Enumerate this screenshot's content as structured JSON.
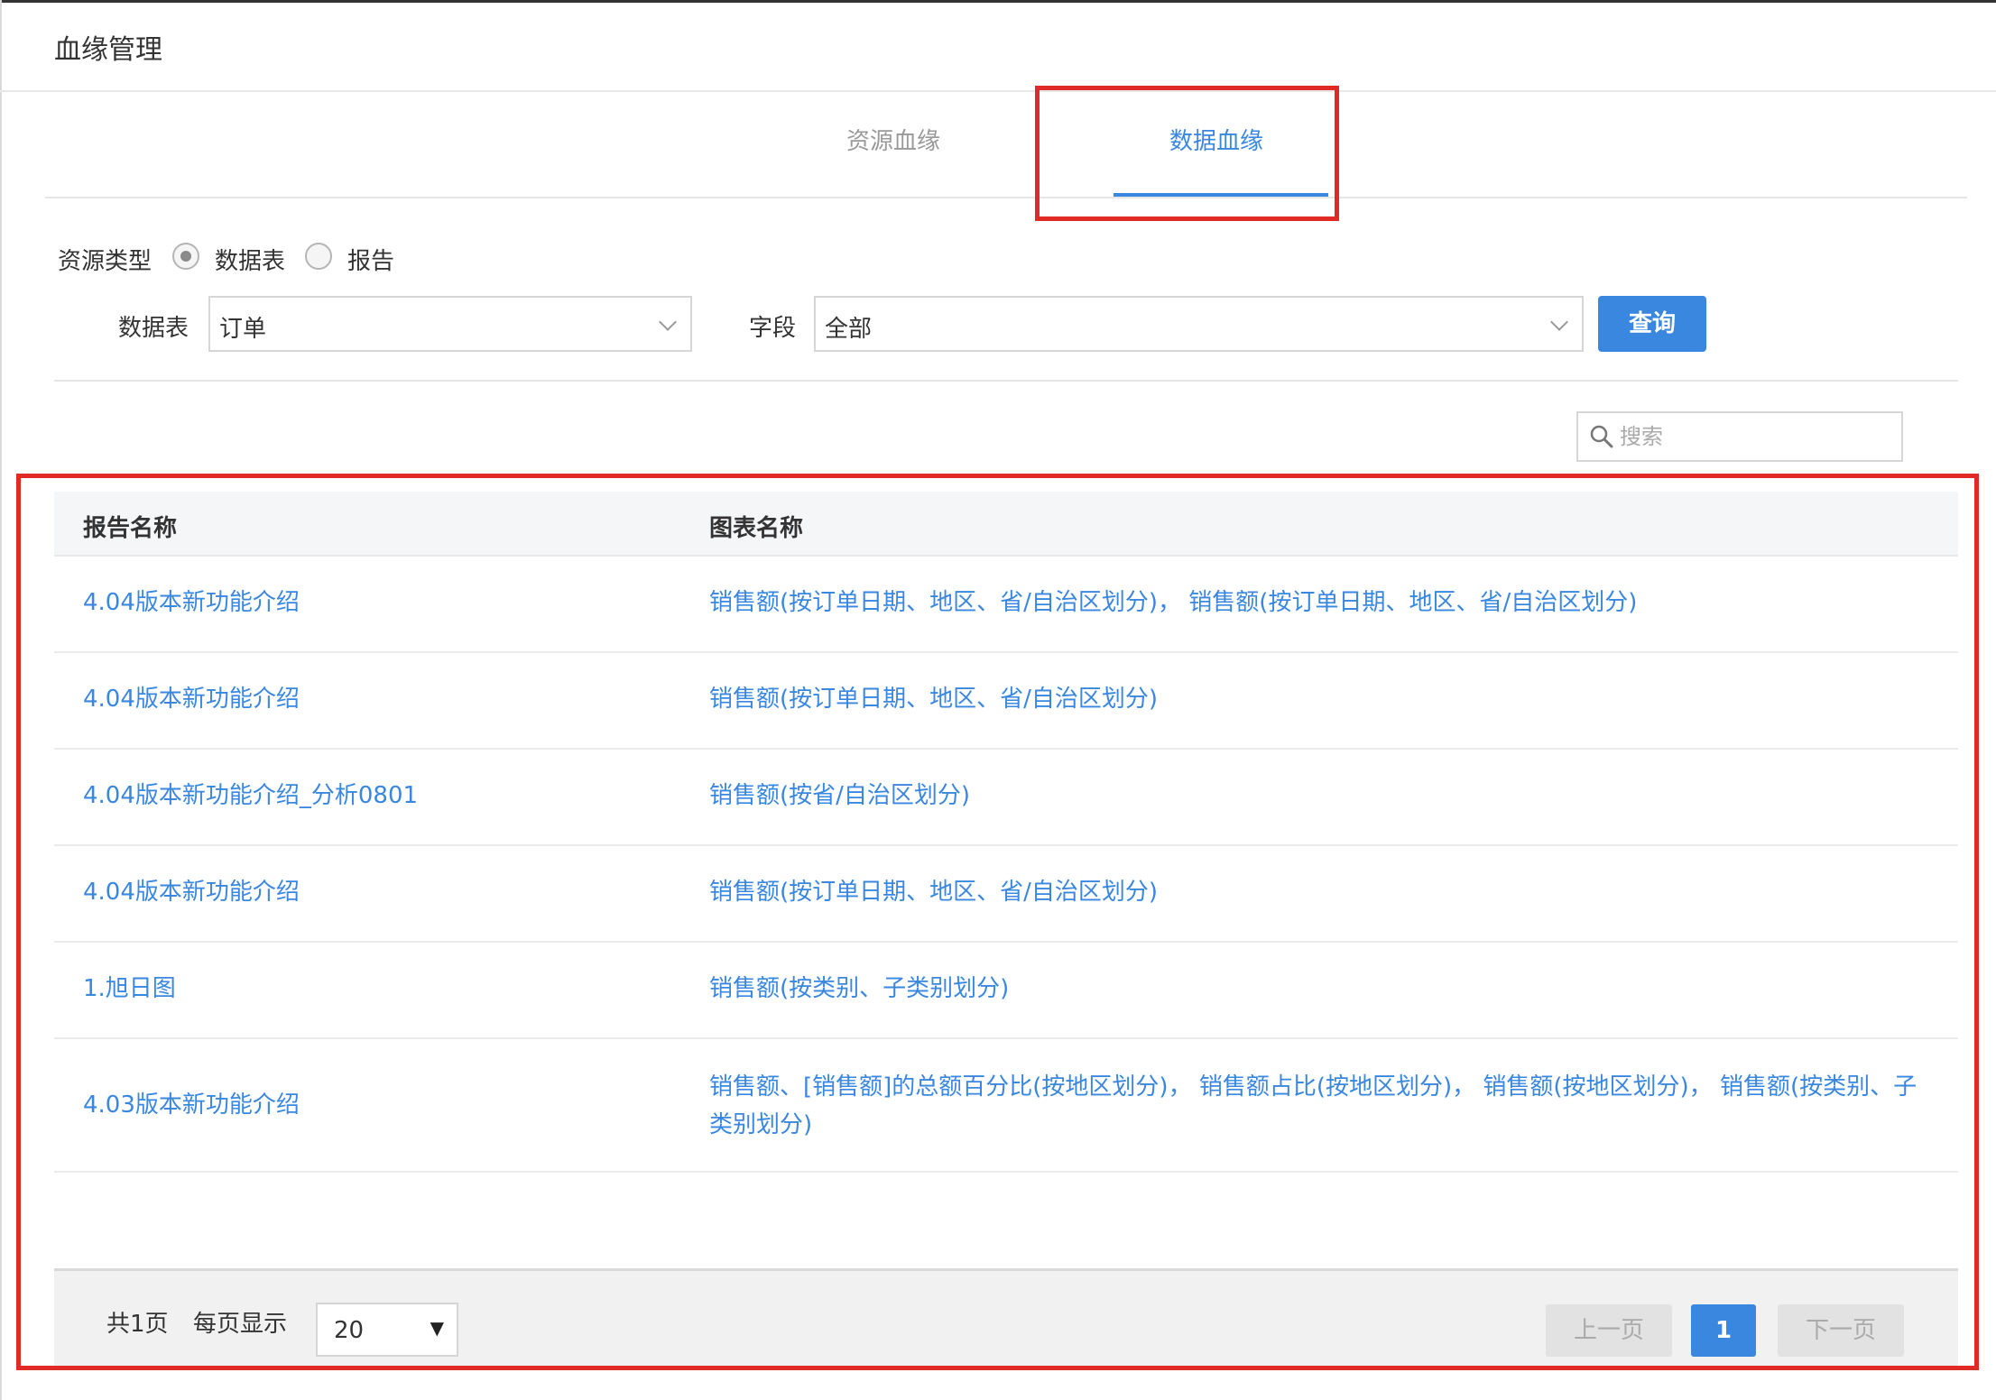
{
  "page": {
    "title": "血缘管理"
  },
  "tabs": [
    {
      "label": "资源血缘",
      "active": false
    },
    {
      "label": "数据血缘",
      "active": true
    }
  ],
  "filters": {
    "resource_type_label": "资源类型",
    "options": [
      {
        "label": "数据表",
        "checked": true
      },
      {
        "label": "报告",
        "checked": false
      }
    ],
    "table_label": "数据表",
    "table_value": "订单",
    "field_label": "字段",
    "field_value": "全部",
    "query_button": "查询"
  },
  "search": {
    "placeholder": "搜索",
    "value": ""
  },
  "table": {
    "headers": [
      "报告名称",
      "图表名称"
    ],
    "rows": [
      {
        "report": "4.04版本新功能介绍",
        "charts": "销售额(按订单日期、地区、省/自治区划分)，  销售额(按订单日期、地区、省/自治区划分)"
      },
      {
        "report": "4.04版本新功能介绍",
        "charts": "销售额(按订单日期、地区、省/自治区划分)"
      },
      {
        "report": "4.04版本新功能介绍_分析0801",
        "charts": "销售额(按省/自治区划分)"
      },
      {
        "report": "4.04版本新功能介绍",
        "charts": "销售额(按订单日期、地区、省/自治区划分)"
      },
      {
        "report": "1.旭日图",
        "charts": "销售额(按类别、子类别划分)"
      },
      {
        "report": "4.03版本新功能介绍",
        "charts": "销售额、[销售额]的总额百分比(按地区划分)，  销售额占比(按地区划分)，  销售额(按地区划分)，  销售额(按类别、子类别划分)"
      }
    ]
  },
  "pagination": {
    "total_pages": "共1页",
    "per_page_label": "每页显示",
    "page_size": "20",
    "prev": "上一页",
    "current": "1",
    "next": "下一页"
  },
  "colors": {
    "accent": "#3a87e0",
    "highlight": "#e02a25"
  }
}
